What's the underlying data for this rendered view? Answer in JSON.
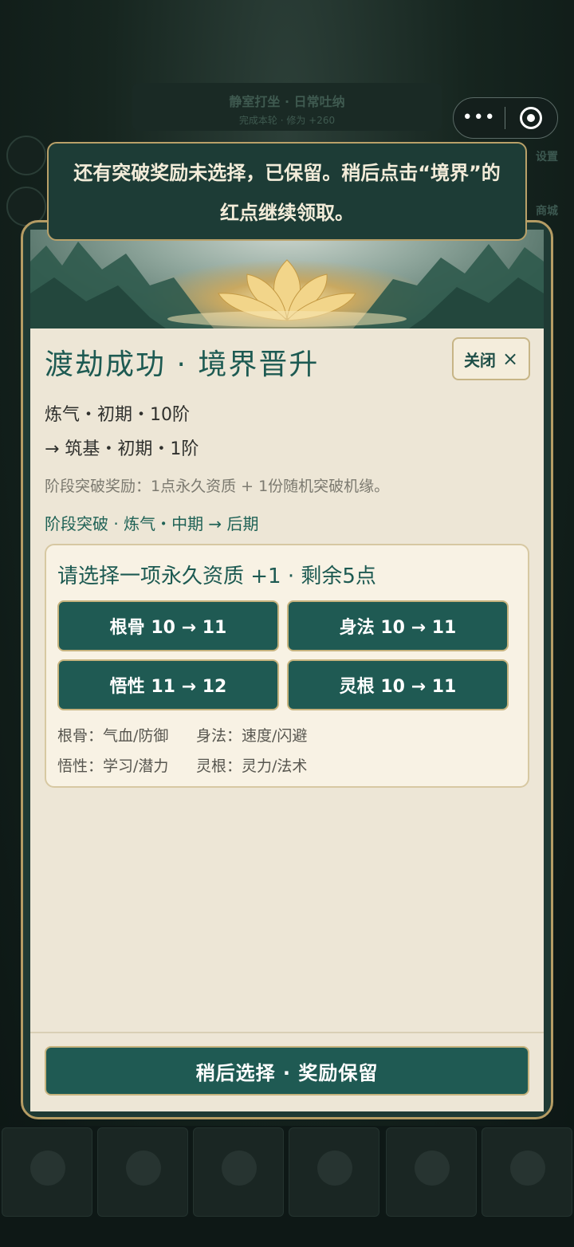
{
  "background": {
    "top_title": "静室打坐 · 日常吐纳",
    "top_subtitle": "完成本轮 · 修为 +260",
    "side_labels": [
      "设置",
      "商城"
    ]
  },
  "capsule": {
    "more_icon": "more-dots-icon",
    "close_icon": "target-circle-icon"
  },
  "toast": {
    "text": "还有突破奖励未选择，已保留。稍后点击“境界”的红点继续领取。"
  },
  "modal": {
    "title": "渡劫成功 · 境界晋升",
    "close_label": "关闭",
    "close_icon": "×",
    "realm_from": "炼气・初期・10阶",
    "realm_to": "→ 筑基・初期・1阶",
    "reward_desc": "阶段突破奖励：1点永久资质 + 1份随机突破机缘。",
    "stage_text": "阶段突破 · 炼气・中期 → 后期",
    "choose": {
      "title": "请选择一项永久资质 +1 · 剩余5点",
      "options": [
        {
          "label": "根骨 10 → 11"
        },
        {
          "label": "身法 10 → 11"
        },
        {
          "label": "悟性 11 → 12"
        },
        {
          "label": "灵根 10 → 11"
        }
      ],
      "hints": [
        "根骨：气血/防御",
        "身法：速度/闪避",
        "悟性：学习/潜力",
        "灵根：灵力/法术"
      ]
    },
    "later_label": "稍后选择 · 奖励保留"
  }
}
